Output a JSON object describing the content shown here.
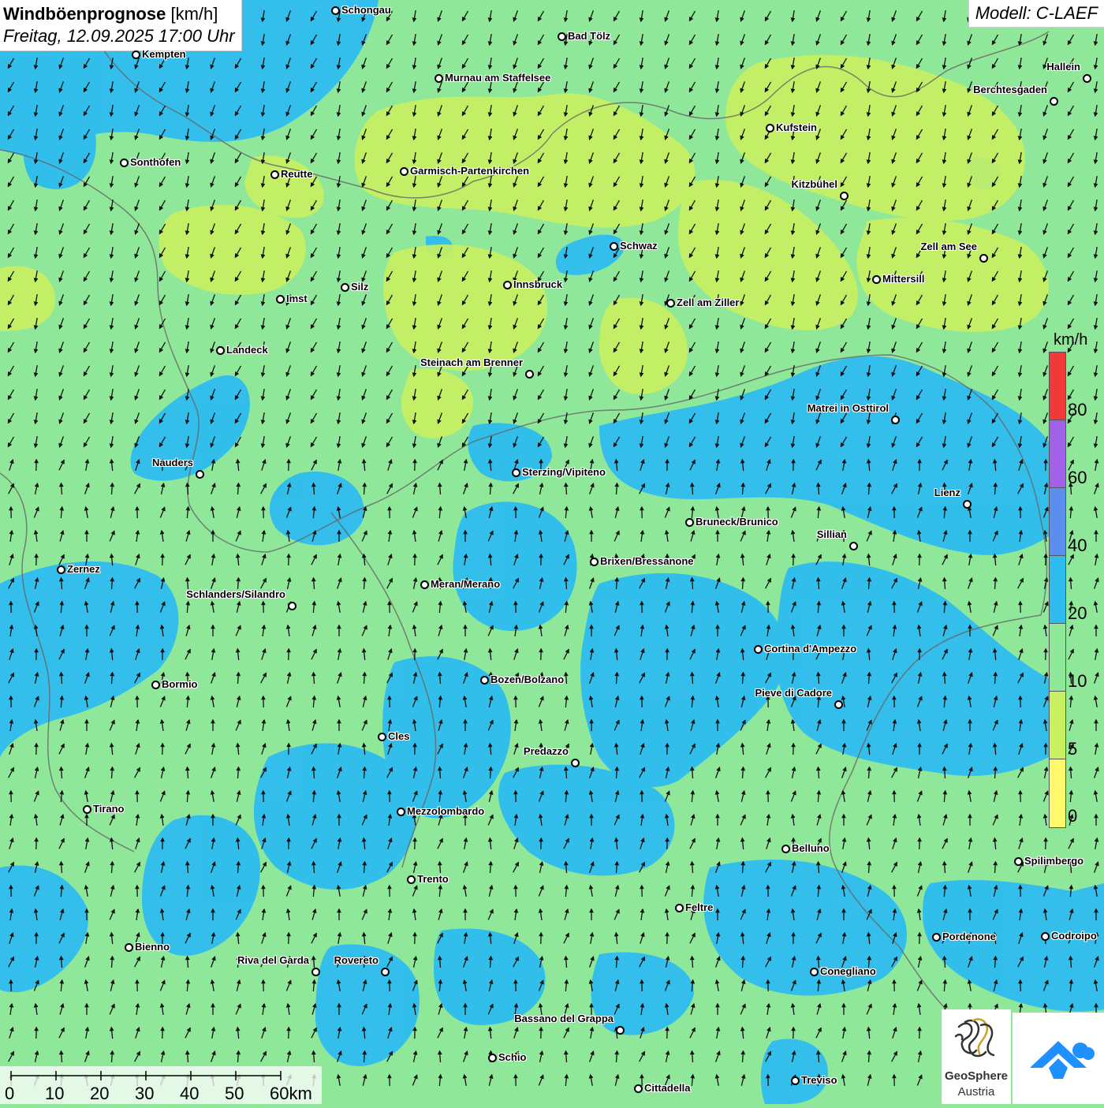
{
  "header": {
    "title_bold": "Windböenprognose",
    "title_unit": "[km/h]",
    "datetime": "Freitag, 12.09.2025 17:00 Uhr",
    "model": "Modell: C-LAEF"
  },
  "legend": {
    "unit": "km/h",
    "labels": [
      "80",
      "60",
      "40",
      "20",
      "10",
      "5",
      "0"
    ],
    "colors": [
      "#f03a3a",
      "#a060e8",
      "#5c8ef0",
      "#2ebcf0",
      "#8fe89a",
      "#c8f060",
      "#fff86a"
    ]
  },
  "scale_bar": {
    "labels": [
      "0",
      "10",
      "20",
      "30",
      "40",
      "50",
      "60km"
    ]
  },
  "logos": {
    "geosphere_line1": "GeoSphere",
    "geosphere_line2": "Austria"
  },
  "cities": [
    {
      "name": "Schongau"
    },
    {
      "name": "Bad Tölz"
    },
    {
      "name": "Kempten"
    },
    {
      "name": "Murnau am Staffelsee"
    },
    {
      "name": "Hallein"
    },
    {
      "name": "Berchtesgaden"
    },
    {
      "name": "Kufstein"
    },
    {
      "name": "Sonthofen"
    },
    {
      "name": "Reutte"
    },
    {
      "name": "Garmisch-Partenkirchen"
    },
    {
      "name": "Kitzbühel"
    },
    {
      "name": "Schwaz"
    },
    {
      "name": "Zell am See"
    },
    {
      "name": "Mittersill"
    },
    {
      "name": "Silz"
    },
    {
      "name": "Innsbruck"
    },
    {
      "name": "Imst"
    },
    {
      "name": "Zell am Ziller"
    },
    {
      "name": "Landeck"
    },
    {
      "name": "Steinach am Brenner"
    },
    {
      "name": "Matrei in Osttirol"
    },
    {
      "name": "Nauders"
    },
    {
      "name": "Sterzing/Vipiteno"
    },
    {
      "name": "Lienz"
    },
    {
      "name": "Bruneck/Brunico"
    },
    {
      "name": "Sillian"
    },
    {
      "name": "Zernez"
    },
    {
      "name": "Brixen/Bressanone"
    },
    {
      "name": "Meran/Merano"
    },
    {
      "name": "Schlanders/Silandro"
    },
    {
      "name": "Cortina d'Ampezzo"
    },
    {
      "name": "Bozen/Bolzano"
    },
    {
      "name": "Bormio"
    },
    {
      "name": "Pieve di Cadore"
    },
    {
      "name": "Cles"
    },
    {
      "name": "Predazzo"
    },
    {
      "name": "Tirano"
    },
    {
      "name": "Mezzolombardo"
    },
    {
      "name": "Belluno"
    },
    {
      "name": "Spilimbergo"
    },
    {
      "name": "Trento"
    },
    {
      "name": "Feltre"
    },
    {
      "name": "Pordenone"
    },
    {
      "name": "Codroipo"
    },
    {
      "name": "Bienno"
    },
    {
      "name": "Riva del Garda"
    },
    {
      "name": "Rovereto"
    },
    {
      "name": "Conegliano"
    },
    {
      "name": "Bassano del Grappa"
    },
    {
      "name": "Schio"
    },
    {
      "name": "Treviso"
    },
    {
      "name": "Cittadella"
    }
  ]
}
